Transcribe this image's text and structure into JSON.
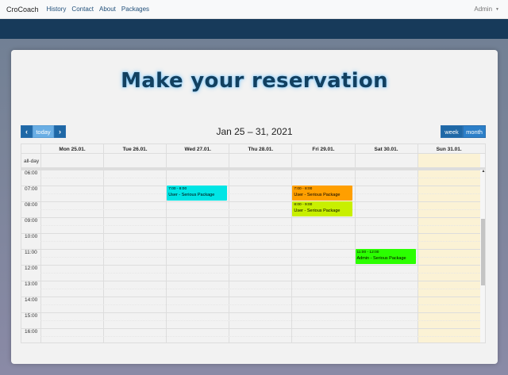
{
  "navbar": {
    "brand": "CroCoach",
    "links": [
      "History",
      "Contact",
      "About",
      "Packages"
    ],
    "user": "Admin"
  },
  "page": {
    "title": "Make your reservation"
  },
  "toolbar": {
    "prev_label": "‹",
    "today_label": "today",
    "next_label": "›",
    "range": "Jan 25 – 31, 2021",
    "week_label": "week",
    "month_label": "month"
  },
  "calendar": {
    "allday_label": "all-day",
    "days": [
      "Mon 25.01.",
      "Tue 26.01.",
      "Wed 27.01.",
      "Thu 28.01.",
      "Fri 29.01.",
      "Sat 30.01.",
      "Sun 31.01."
    ],
    "times": [
      "06:00",
      "07:00",
      "08:00",
      "09:00",
      "10:00",
      "11:00",
      "12:00",
      "13:00",
      "14:00",
      "15:00",
      "16:00"
    ],
    "today_index": 6,
    "events": [
      {
        "day": 2,
        "start": 7,
        "end": 8,
        "time": "7:00 - 8:00",
        "title": "User - Serious Package",
        "color": "#00e5e5"
      },
      {
        "day": 4,
        "start": 7,
        "end": 8,
        "time": "7:00 - 8:00",
        "title": "User - Serious Package",
        "color": "#ff9f00"
      },
      {
        "day": 4,
        "start": 8,
        "end": 9,
        "time": "8:00 - 9:00",
        "title": "User - Serious Package",
        "color": "#c8ef00"
      },
      {
        "day": 5,
        "start": 11,
        "end": 12,
        "time": "11:00 - 12:00",
        "title": "Admin - Serious Package",
        "color": "#2bff00"
      }
    ]
  },
  "colors": {
    "primary_button": "#2c7fc8",
    "today_highlight": "#fbf2d5",
    "header_band": "#173a5a"
  }
}
